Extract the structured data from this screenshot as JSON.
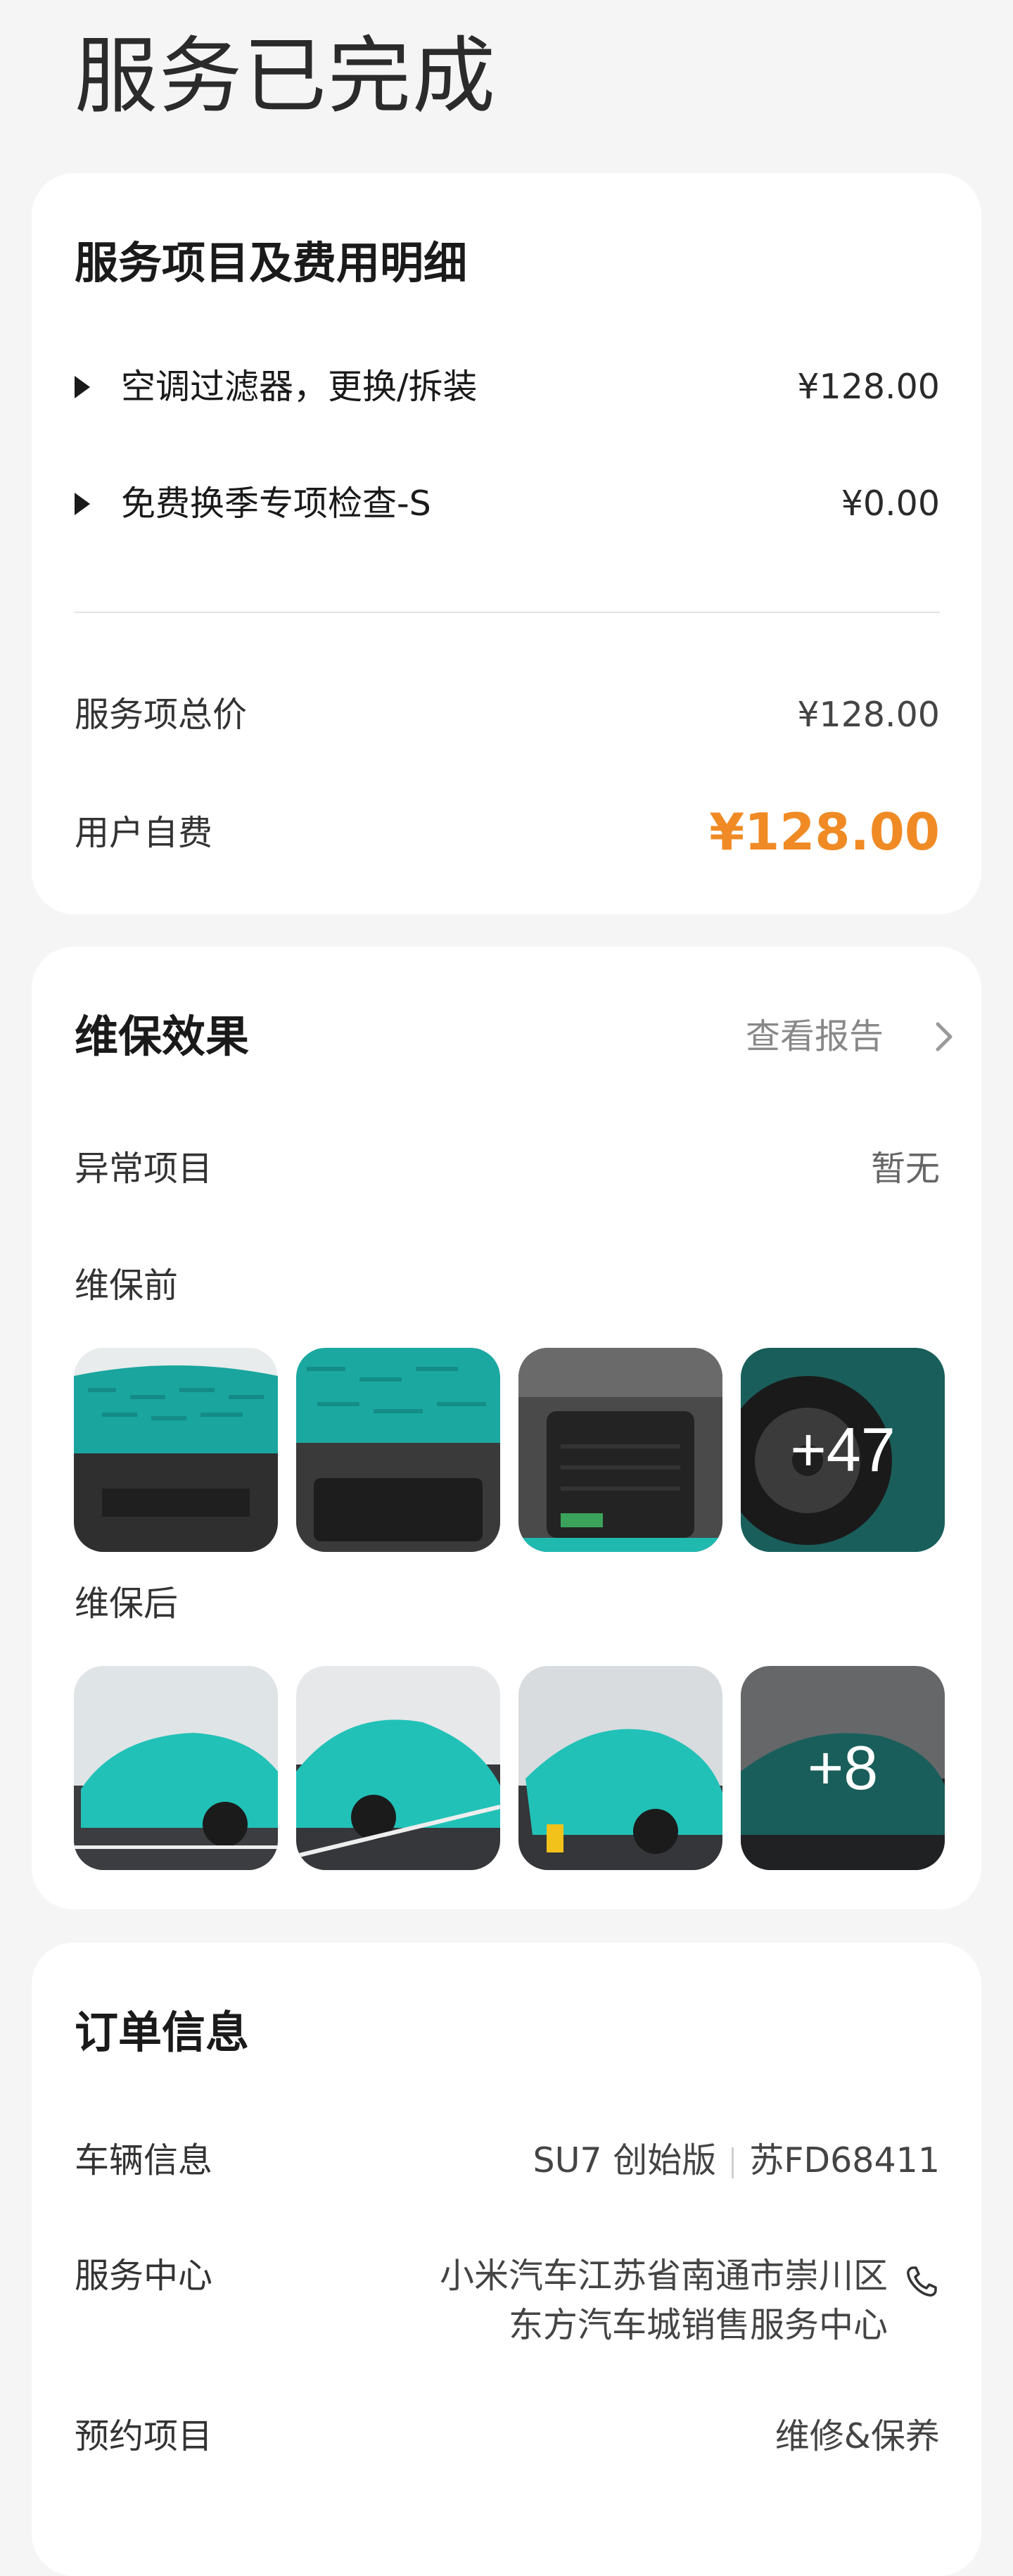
{
  "page": {
    "title": "服务已完成"
  },
  "fee_card": {
    "title": "服务项目及费用明细",
    "items": [
      {
        "name": "空调过滤器，更换/拆装",
        "price": "¥128.00"
      },
      {
        "name": "免费换季专项检查-S",
        "price": "¥0.00"
      }
    ],
    "total_label": "服务项总价",
    "total_value": "¥128.00",
    "self_pay_label": "用户自费",
    "self_pay_value": "¥128.00",
    "accent_color": "#f08a24"
  },
  "maintenance_card": {
    "title": "维保效果",
    "report_link": "查看报告",
    "anomaly_label": "异常项目",
    "anomaly_value": "暂无",
    "before_label": "维保前",
    "before_more": "+47",
    "after_label": "维保后",
    "after_more": "+8",
    "car_color": "#1fb9b0"
  },
  "order_card": {
    "title": "订单信息",
    "vehicle_label": "车辆信息",
    "vehicle_model": "SU7 创始版",
    "vehicle_plate": "苏FD68411",
    "center_label": "服务中心",
    "center_line1": "小米汽车江苏省南通市崇川区",
    "center_line2": "东方汽车城销售服务中心",
    "booking_label": "预约项目",
    "booking_value": "维修&保养"
  },
  "icons": [
    "play-triangle-icon",
    "chevron-right-icon",
    "phone-icon"
  ]
}
